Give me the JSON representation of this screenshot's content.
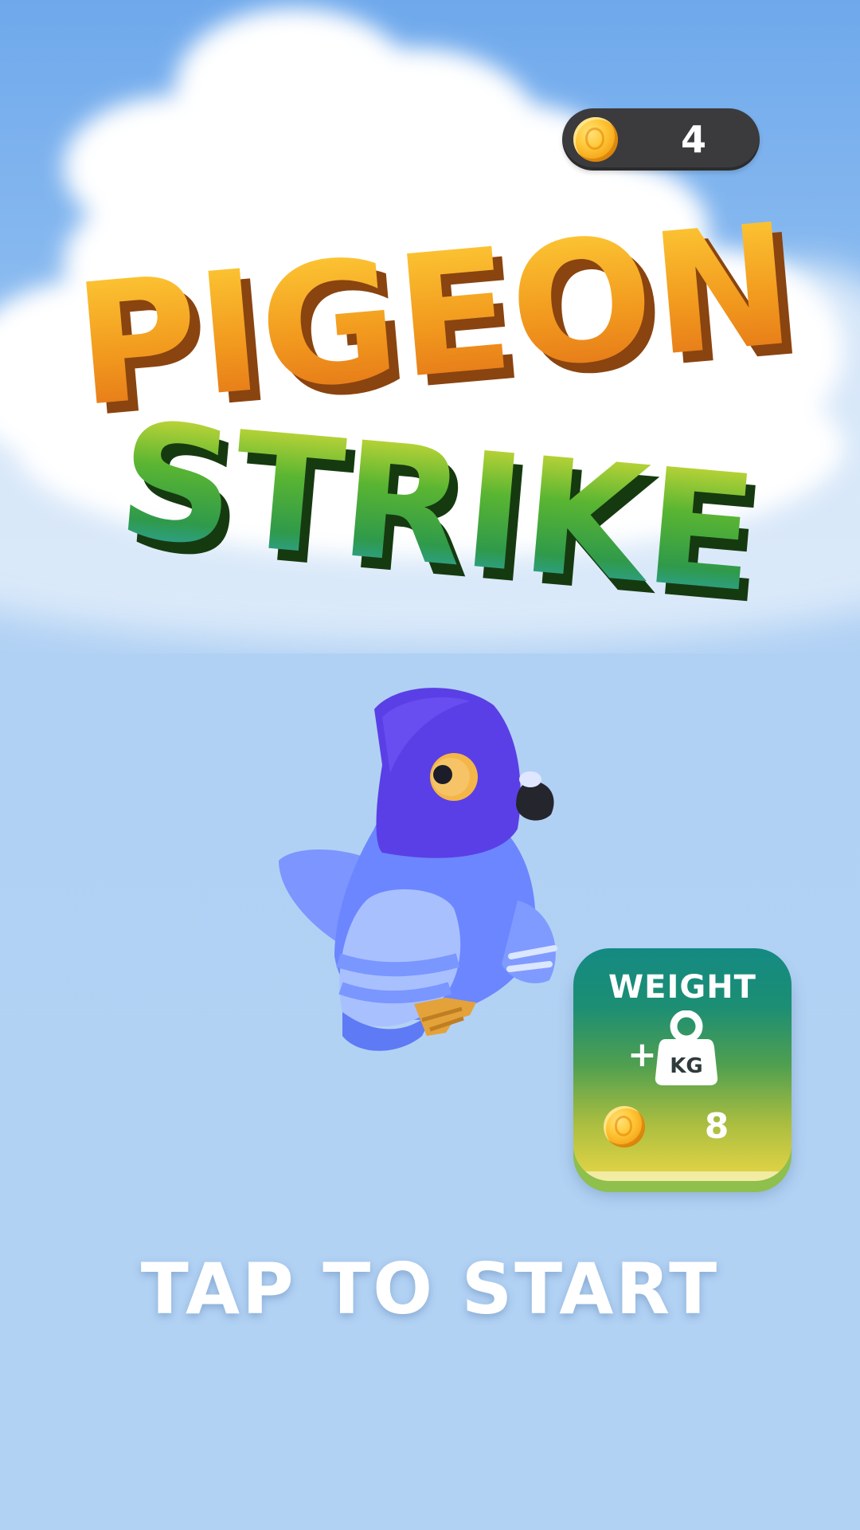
{
  "hud": {
    "coins": "4",
    "coin_icon": "gold-coin-icon"
  },
  "title": {
    "line1": "PIGEON",
    "line2": "STRIKE",
    "line1_colors": [
      "#ffd33a",
      "#f08a1c",
      "#d4641a"
    ],
    "line2_colors": [
      "#f6e13a",
      "#4aa334",
      "#2a9fe0"
    ]
  },
  "character": {
    "name": "pigeon",
    "head_color": "#5a3fe6",
    "body_color": "#6f8cff"
  },
  "upgrade": {
    "title": "WEIGHT",
    "plus": "+",
    "icon_label": "KG",
    "cost": "8",
    "colors": {
      "top": "#148a82",
      "bottom": "#e8d646"
    }
  },
  "prompt": {
    "text": "TAP TO START"
  }
}
